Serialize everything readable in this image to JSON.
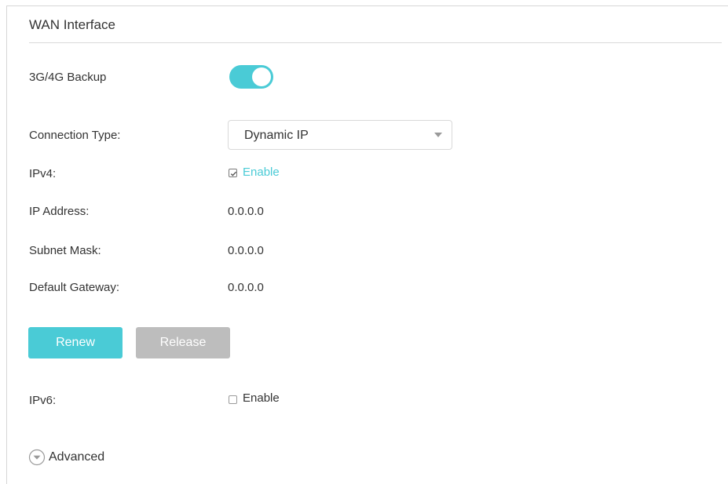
{
  "section": {
    "title": "WAN Interface"
  },
  "backup": {
    "label": "3G/4G Backup",
    "enabled": true
  },
  "connection_type": {
    "label": "Connection Type:",
    "selected": "Dynamic IP"
  },
  "ipv4": {
    "label": "IPv4:",
    "checkbox_label": "Enable",
    "checked": true
  },
  "ip_address": {
    "label": "IP Address:",
    "value": "0.0.0.0"
  },
  "subnet_mask": {
    "label": "Subnet Mask:",
    "value": "0.0.0.0"
  },
  "default_gateway": {
    "label": "Default Gateway:",
    "value": "0.0.0.0"
  },
  "buttons": {
    "renew": "Renew",
    "release": "Release"
  },
  "ipv6": {
    "label": "IPv6:",
    "checkbox_label": "Enable",
    "checked": false
  },
  "advanced": {
    "label": "Advanced"
  },
  "colors": {
    "accent": "#4acbd6",
    "disabled_button": "#bdbdbd",
    "text": "#333333"
  },
  "icons": {
    "toggle": "toggle-switch-on",
    "dropdown": "chevron-down-icon",
    "advanced": "circle-chevron-down-icon"
  }
}
